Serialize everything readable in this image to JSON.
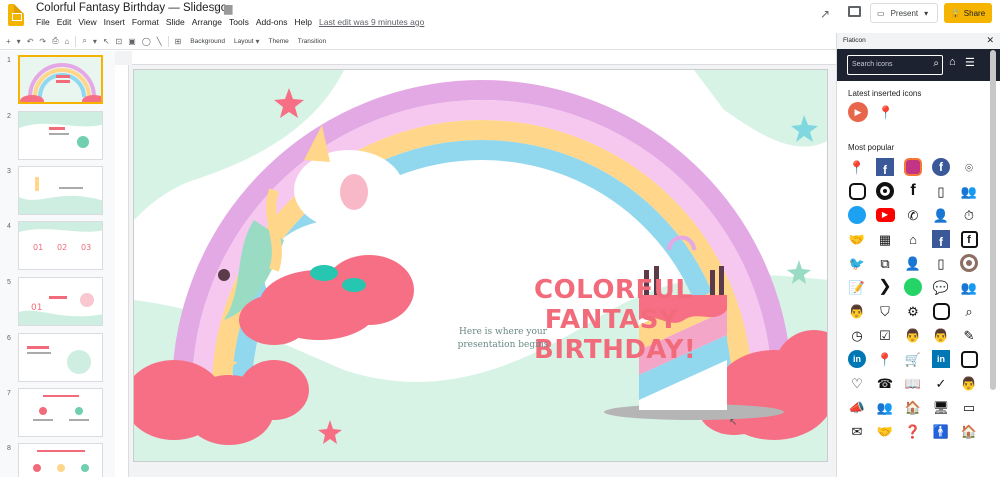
{
  "app": {
    "title": "Colorful Fantasy Birthday — Slidesgo",
    "menu": [
      "File",
      "Edit",
      "View",
      "Insert",
      "Format",
      "Slide",
      "Arrange",
      "Tools",
      "Add-ons",
      "Help"
    ],
    "last_edit": "Last edit was 9 minutes ago",
    "present_label": "Present",
    "share_label": "Share",
    "accent": "#f4b400"
  },
  "toolbar": {
    "background_label": "Background",
    "layout_label": "Layout",
    "theme_label": "Theme",
    "transition_label": "Transition"
  },
  "filmstrip": {
    "slides": [
      {
        "num": "1",
        "selected": true
      },
      {
        "num": "2"
      },
      {
        "num": "3"
      },
      {
        "num": "4"
      },
      {
        "num": "5"
      },
      {
        "num": "6"
      },
      {
        "num": "7"
      },
      {
        "num": "8"
      }
    ],
    "thumb4_nums": [
      "01",
      "02",
      "03"
    ],
    "thumb5_num": "01"
  },
  "slide": {
    "title_lines": [
      "COLORFUL",
      "FANTASY",
      "BIRTHDAY!"
    ],
    "subtitle_lines": [
      "Here is where your",
      "presentation begins"
    ],
    "title_color": "#f26b7b"
  },
  "panel": {
    "header": "Flaticon",
    "search_placeholder": "Search icons",
    "latest_label": "Latest inserted icons",
    "popular_label": "Most popular",
    "latest_icons": [
      "play-circle-icon",
      "map-pin-icon"
    ],
    "popular_icons": [
      "map-pin-icon",
      "facebook-icon",
      "instagram-icon",
      "facebook-icon",
      "location-icon",
      "instagram-icon",
      "instagram-icon",
      "facebook-icon",
      "smartphone-icon",
      "group-icon",
      "twitter-icon",
      "youtube-icon",
      "phone-icon",
      "user-icon",
      "stopwatch-icon",
      "handshake-icon",
      "calendar-icon",
      "home-icon",
      "facebook-icon",
      "facebook-icon",
      "twitter-icon",
      "network-icon",
      "user-icon",
      "smartphone-icon",
      "instagram-icon",
      "contract-icon",
      "chevron-right-icon",
      "whatsapp-icon",
      "chat-icon",
      "group-icon",
      "teamwork-icon",
      "shield-icon",
      "gears-icon",
      "instagram-icon",
      "search-icon",
      "clock-icon",
      "checklist-icon",
      "doctor-icon",
      "doctor-icon",
      "syringe-icon",
      "linkedin-icon",
      "map-pin-icon",
      "cart-icon",
      "linkedin-icon",
      "instagram-icon",
      "heart-icon",
      "telephone-icon",
      "book-icon",
      "check-icon",
      "man-icon",
      "megaphone-icon",
      "team-icon",
      "house-icon",
      "monitor-icon",
      "presentation-icon",
      "mail-icon",
      "handshake-icon",
      "question-icon",
      "person-icon",
      "house-icon"
    ]
  }
}
